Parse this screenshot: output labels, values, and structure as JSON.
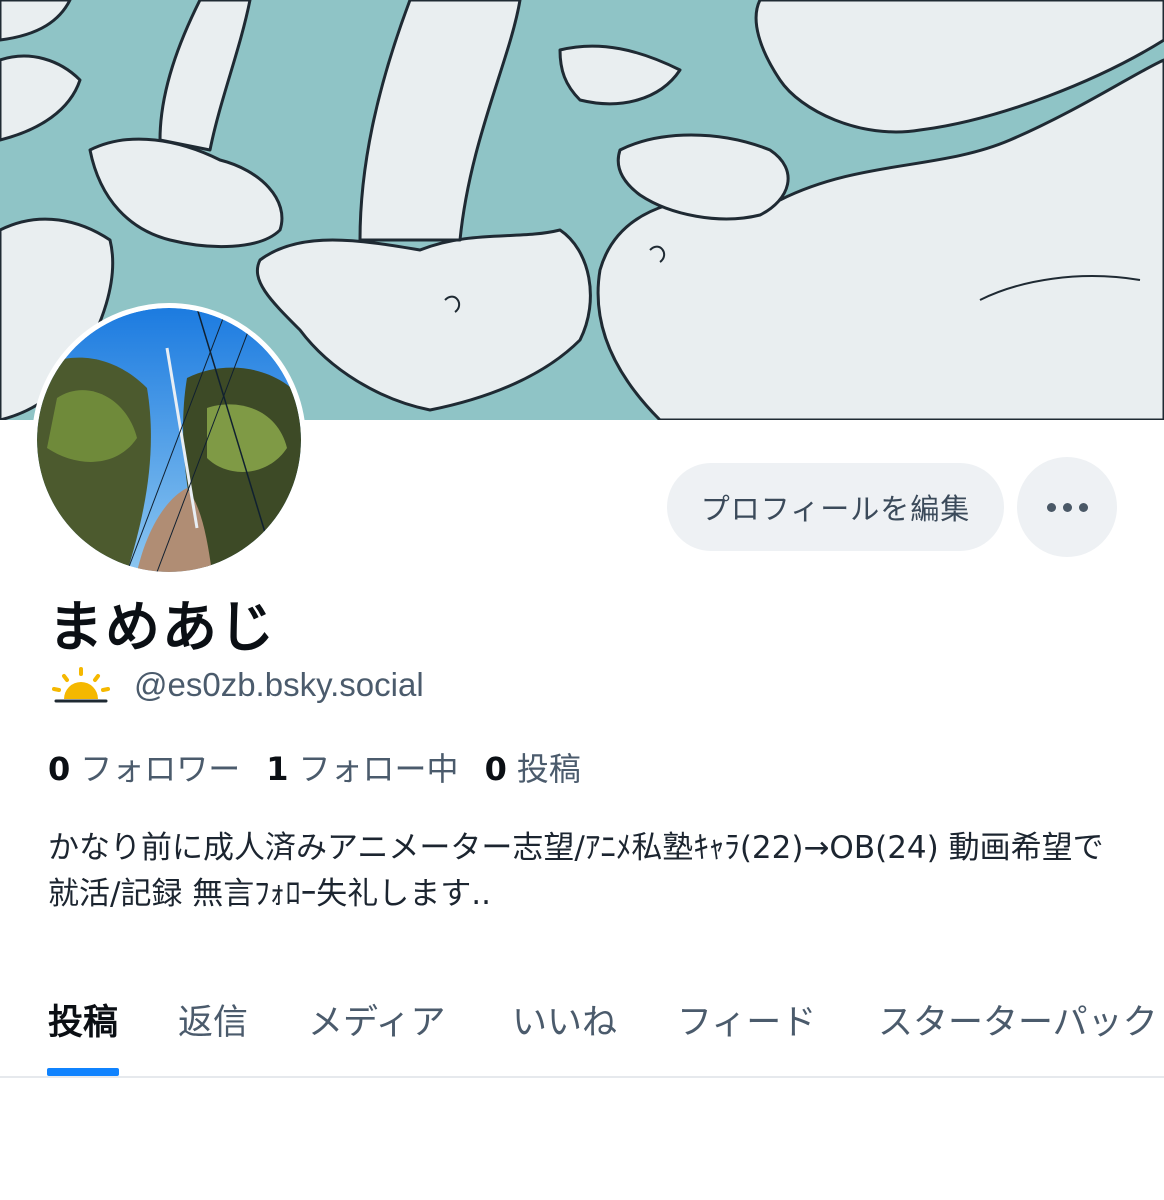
{
  "profile": {
    "display_name": "まめあじ",
    "handle": "@es0zb.bsky.social",
    "bio": "かなり前に成人済みアニメーター志望/ｱﾆﾒ私塾ｷｬﾗ(22)→OB(24) 動画希望で就活/記録 無言ﾌｫﾛｰ失礼します..",
    "status_icon": "sunrise-icon"
  },
  "actions": {
    "edit_profile_label": "プロフィールを編集",
    "more_icon": "ellipsis-icon"
  },
  "stats": {
    "followers_count": "0",
    "followers_label": "フォロワー",
    "following_count": "1",
    "following_label": "フォロー中",
    "posts_count": "0",
    "posts_label": "投稿"
  },
  "tabs": [
    {
      "label": "投稿",
      "active": true
    },
    {
      "label": "返信",
      "active": false
    },
    {
      "label": "メディア",
      "active": false
    },
    {
      "label": "いいね",
      "active": false
    },
    {
      "label": "フィード",
      "active": false
    },
    {
      "label": "スターターパック",
      "active": false
    }
  ],
  "colors": {
    "accent": "#1083fe",
    "banner_bg": "#8fc4c6",
    "button_bg": "#eef1f4",
    "muted_text": "#4b5b6c",
    "sun": "#f5b800"
  }
}
